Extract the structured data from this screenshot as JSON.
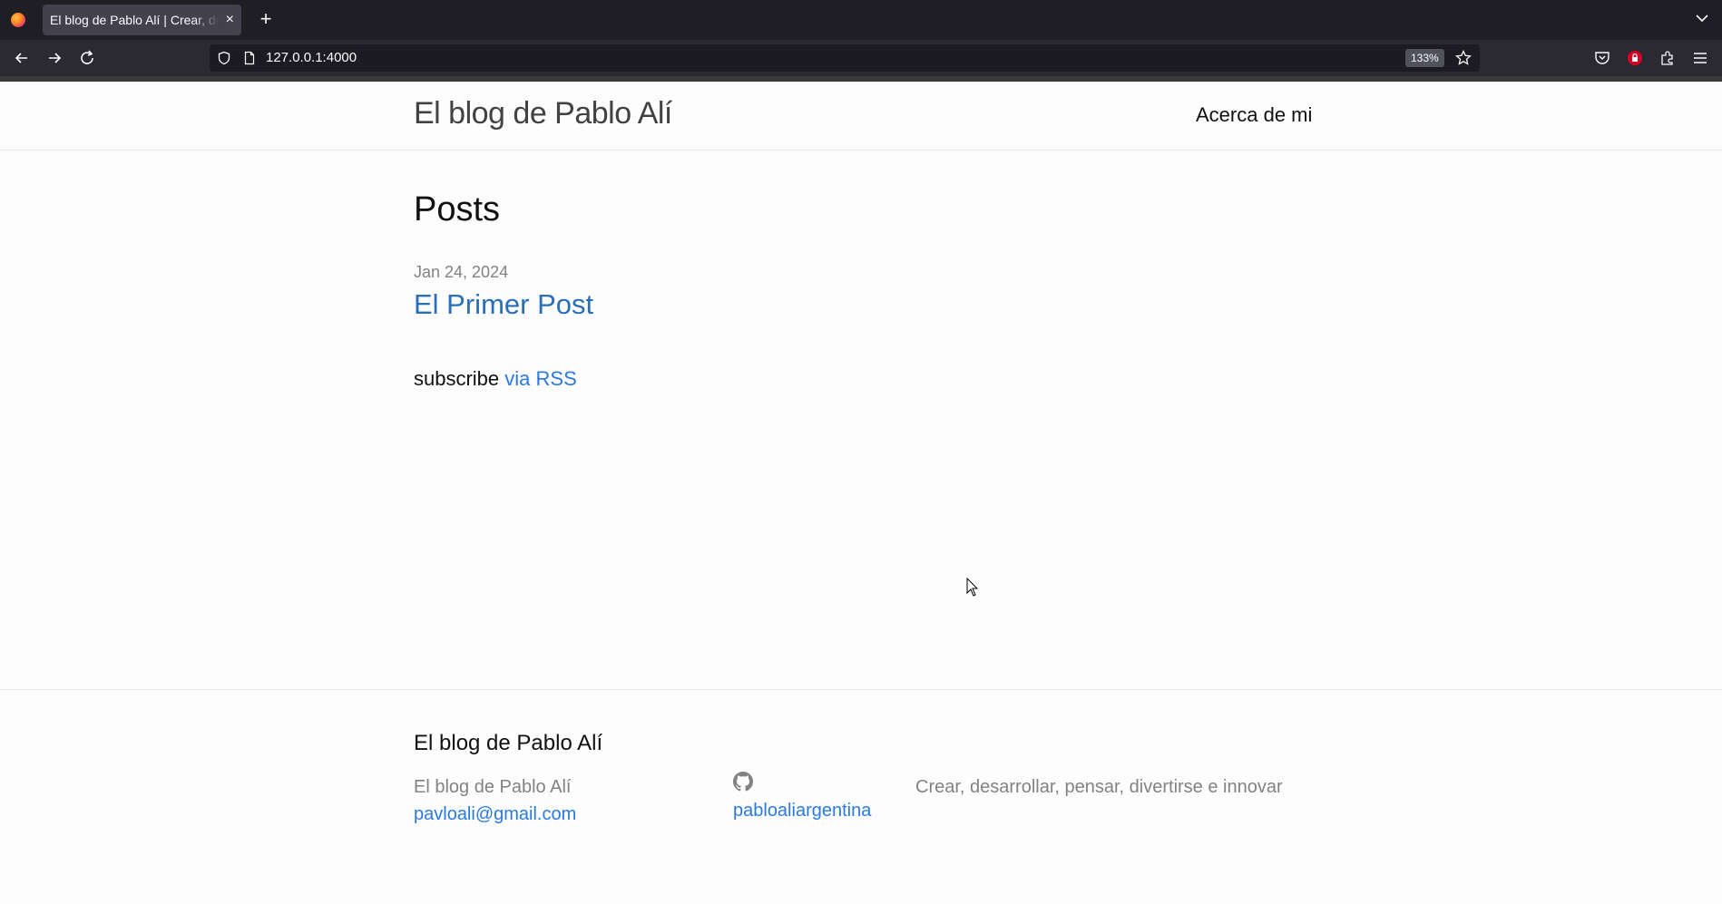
{
  "browser": {
    "tab_title": "El blog de Pablo Alí | Crear, desarrollar, pensar, divertirse e innovar",
    "new_tab_symbol": "+",
    "close_symbol": "×",
    "url": "127.0.0.1:4000",
    "zoom": "133%"
  },
  "header": {
    "site_title": "El blog de Pablo Alí",
    "nav_about": "Acerca de mi"
  },
  "main": {
    "heading": "Posts",
    "posts": [
      {
        "date": "Jan 24, 2024",
        "title": "El Primer Post"
      }
    ],
    "subscribe_text": "subscribe",
    "subscribe_link": "via RSS"
  },
  "footer": {
    "heading": "El blog de Pablo Alí",
    "author_name": "El blog de Pablo Alí",
    "email": "pavloali@gmail.com",
    "github_user": "pabloaliargentina",
    "description": "Crear, desarrollar, pensar, divertirse e innovar"
  },
  "colors": {
    "link": "#2a7ae2",
    "post_link": "#2a6fb5",
    "meta_gray": "#828282",
    "browser_dark": "#2b2a33"
  },
  "icons": [
    "firefox-icon",
    "back-icon",
    "forward-icon",
    "reload-icon",
    "shield-icon",
    "page-icon",
    "star-icon",
    "pocket-icon",
    "extension-lock-icon",
    "extensions-icon",
    "menu-icon",
    "github-icon",
    "chevron-down-icon"
  ]
}
